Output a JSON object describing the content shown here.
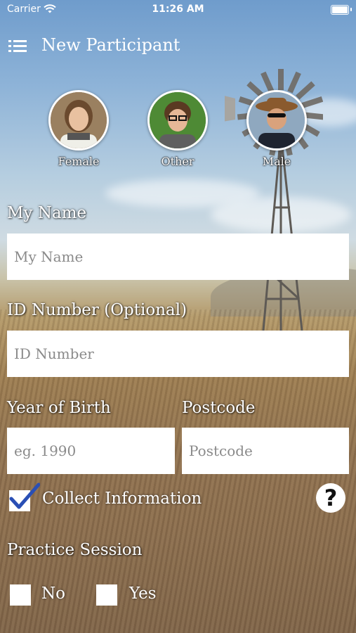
{
  "status_bar": {
    "carrier": "Carrier",
    "time": "11:26 AM"
  },
  "nav": {
    "title": "New Participant",
    "menu_icon": "hamburger-menu-icon"
  },
  "avatars": [
    {
      "label": "Female"
    },
    {
      "label": "Other"
    },
    {
      "label": "Male"
    }
  ],
  "form": {
    "name_label": "My Name",
    "name_placeholder": "My Name",
    "id_label": "ID Number (Optional)",
    "id_placeholder": "ID Number",
    "yob_label": "Year of Birth",
    "yob_placeholder": "eg. 1990",
    "postcode_label": "Postcode",
    "postcode_placeholder": "Postcode",
    "collect_label": "Collect Information",
    "collect_checked": true,
    "help_icon": "?",
    "practice_label": "Practice Session",
    "practice_no": "No",
    "practice_yes": "Yes"
  }
}
